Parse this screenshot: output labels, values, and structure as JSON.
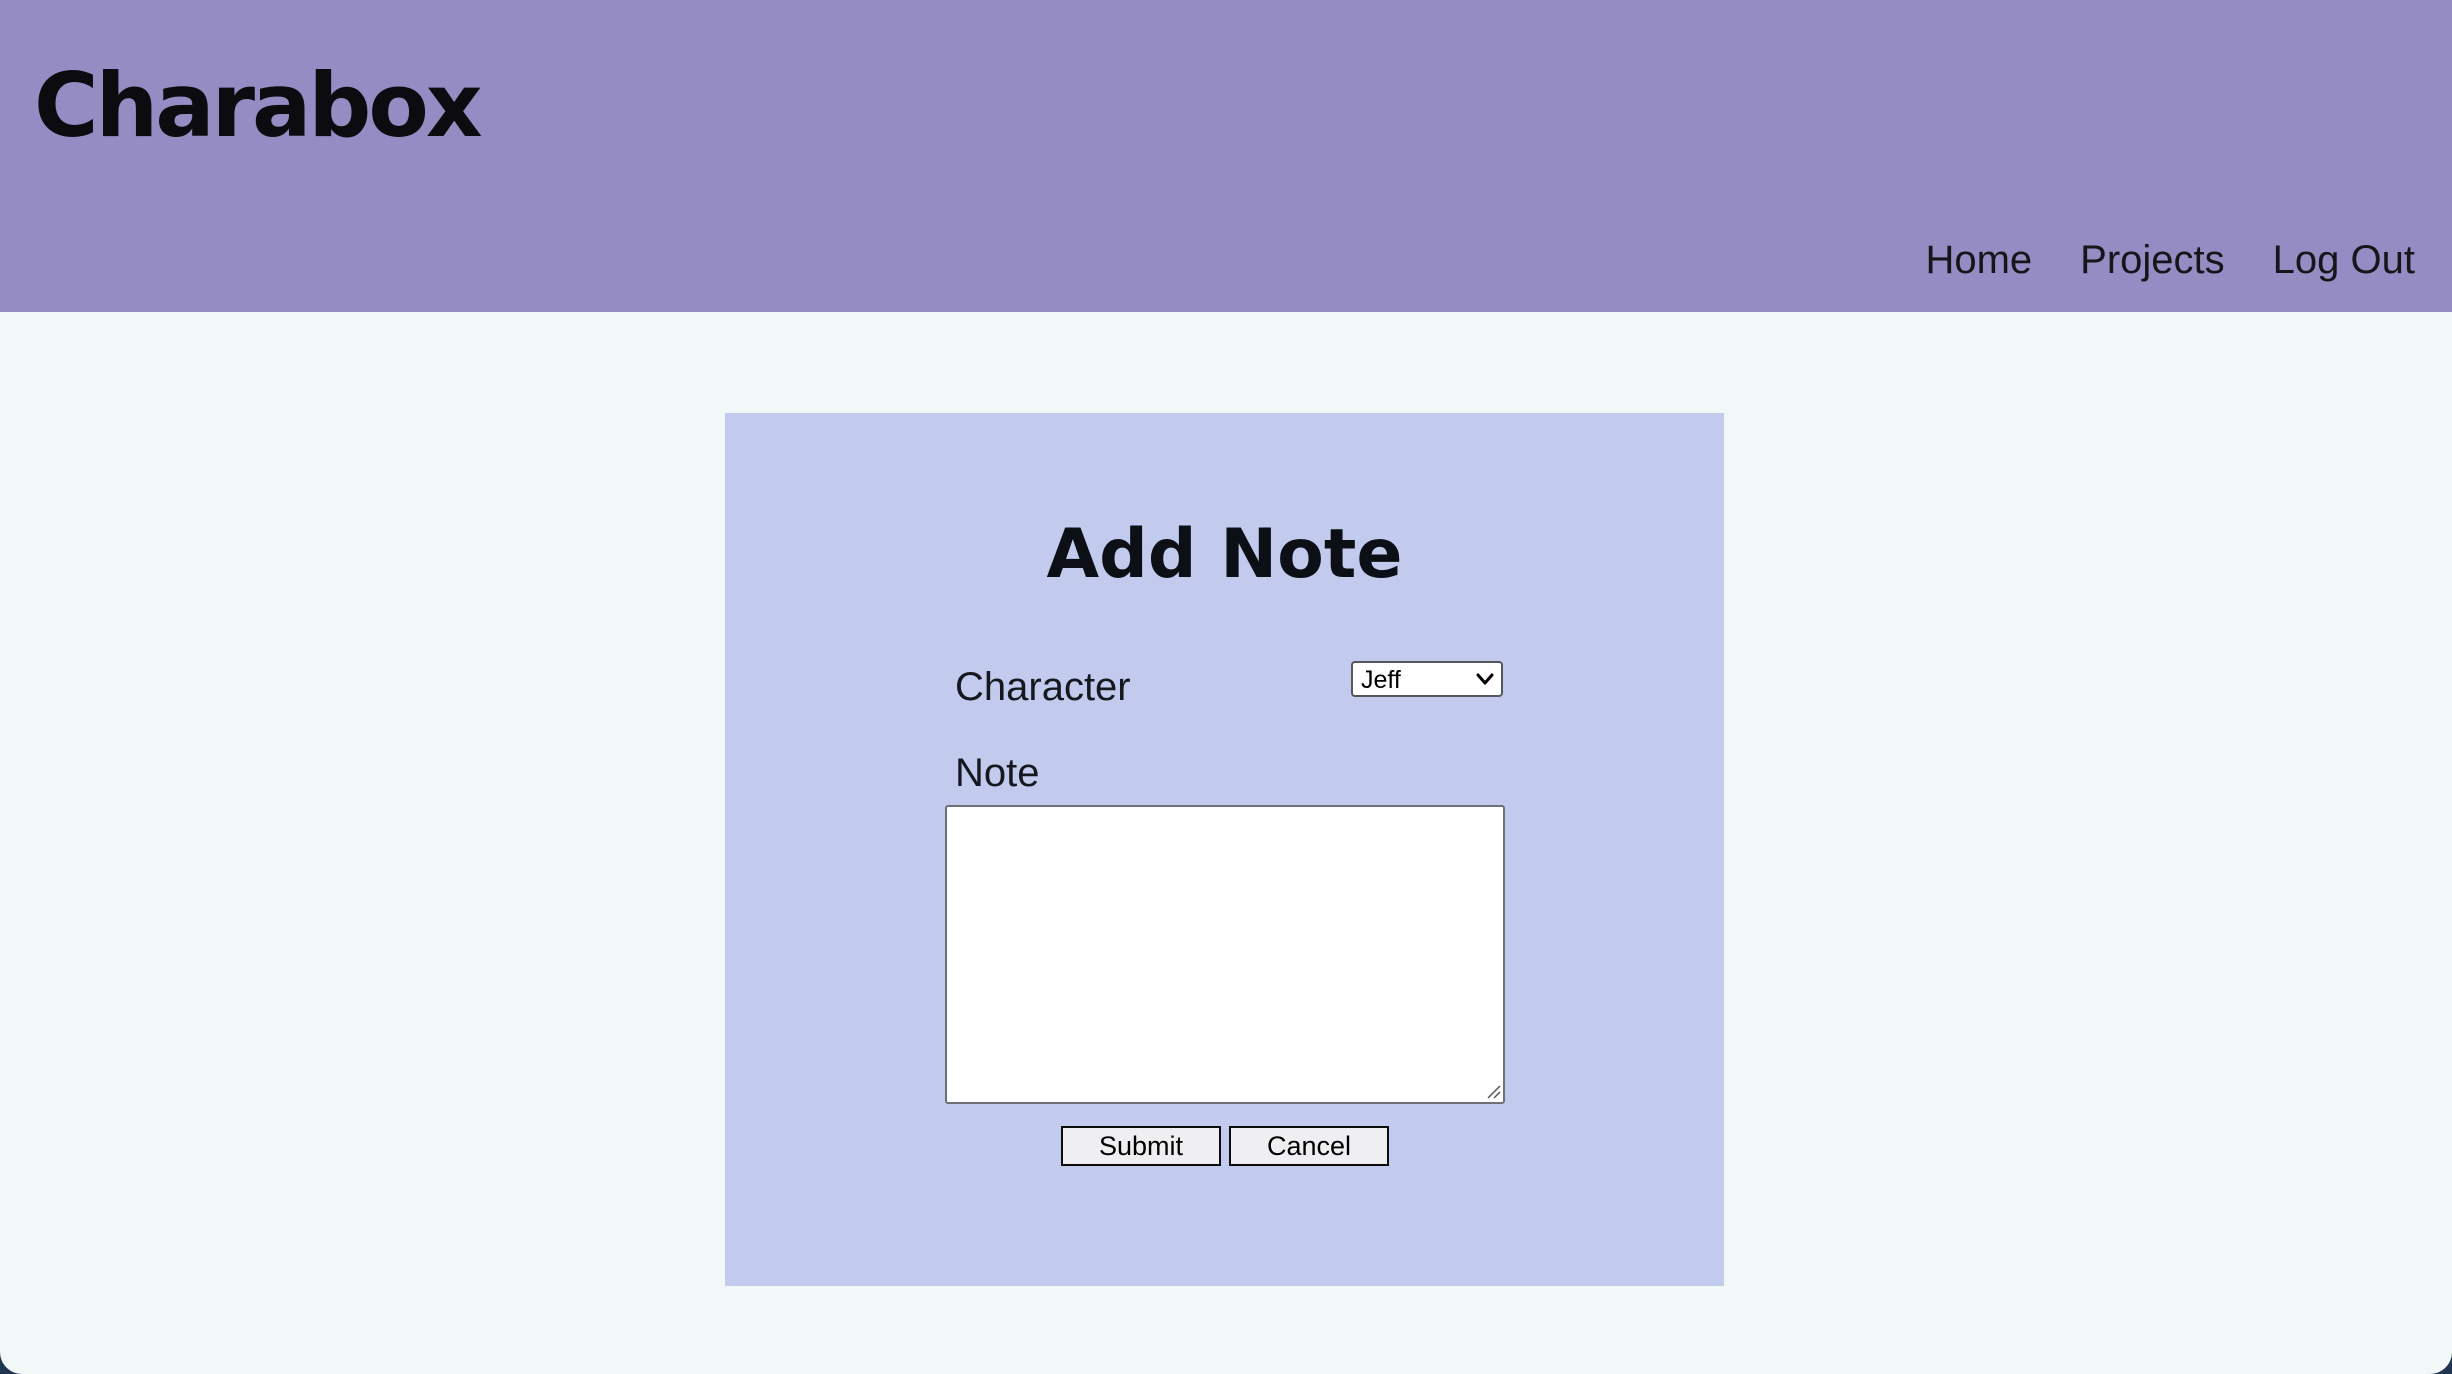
{
  "header": {
    "brand": "Charabox",
    "nav": [
      {
        "label": "Home"
      },
      {
        "label": "Projects"
      },
      {
        "label": "Log Out"
      }
    ],
    "background_color": "#968cc4"
  },
  "form": {
    "title": "Add Note",
    "character_label": "Character",
    "character_selected": "Jeff",
    "note_label": "Note",
    "note_value": "",
    "submit_label": "Submit",
    "cancel_label": "Cancel",
    "card_color": "#c2cbee"
  },
  "page_background": "#f2f8f8"
}
